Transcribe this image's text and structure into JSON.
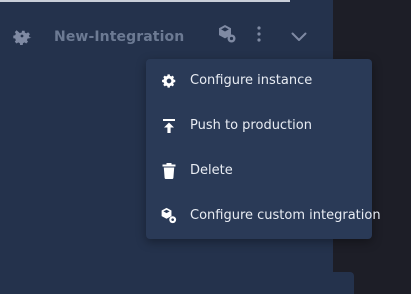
{
  "header": {
    "title": "New-Integration",
    "logo_icon": "gear-icon",
    "custom_integration_icon": "cube-gear-icon",
    "more_icon": "kebab-menu-icon",
    "expand_icon": "chevron-down-icon"
  },
  "menu": {
    "items": [
      {
        "label": "Configure instance",
        "icon": "gear-icon"
      },
      {
        "label": "Push to production",
        "icon": "upload-arrow-icon"
      },
      {
        "label": "Delete",
        "icon": "trash-icon"
      },
      {
        "label": "Configure custom integration",
        "icon": "cube-gear-icon"
      }
    ]
  },
  "colors": {
    "panel": "#24324c",
    "menu": "#2a3a57",
    "title": "#6c7a93",
    "menu_text": "#e8ecf3",
    "icon": "#ffffff",
    "muted_icon": "#7f8aa3"
  }
}
